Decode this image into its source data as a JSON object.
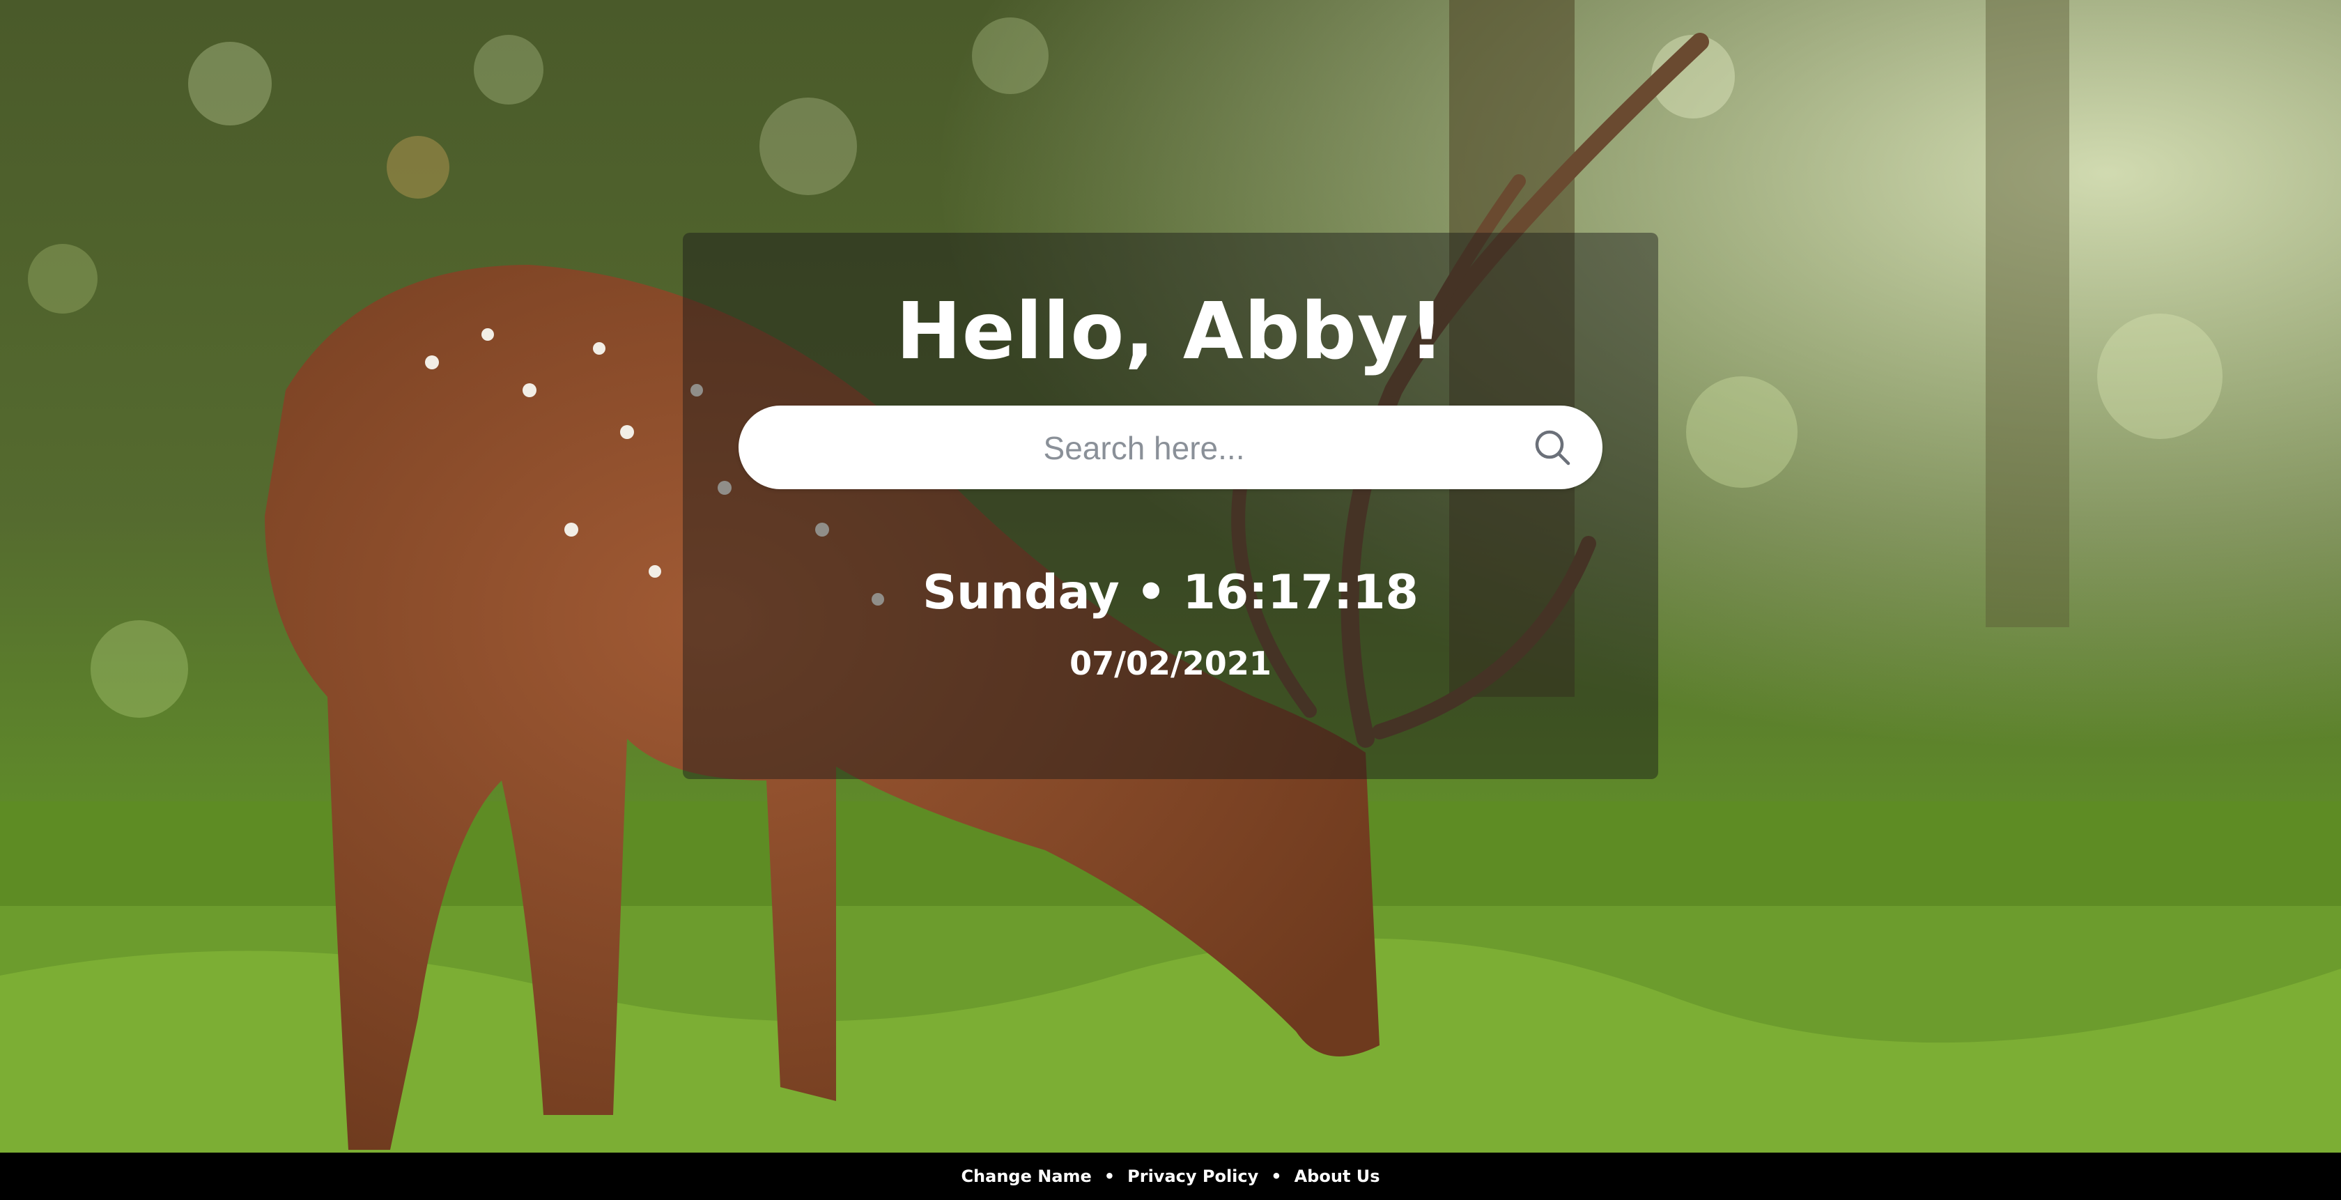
{
  "greeting": "Hello, Abby!",
  "search": {
    "placeholder": "Search here...",
    "value": "",
    "icon": "search-icon"
  },
  "clock": {
    "display": "Sunday • 16:17:18",
    "date": "07/02/2021"
  },
  "footer": {
    "links": [
      "Change Name",
      "Privacy Policy",
      "About Us"
    ],
    "separator": "•"
  },
  "colors": {
    "text": "#ffffff",
    "footer_bg": "#000000",
    "search_bg": "#ffffff",
    "placeholder": "#8a9098"
  }
}
